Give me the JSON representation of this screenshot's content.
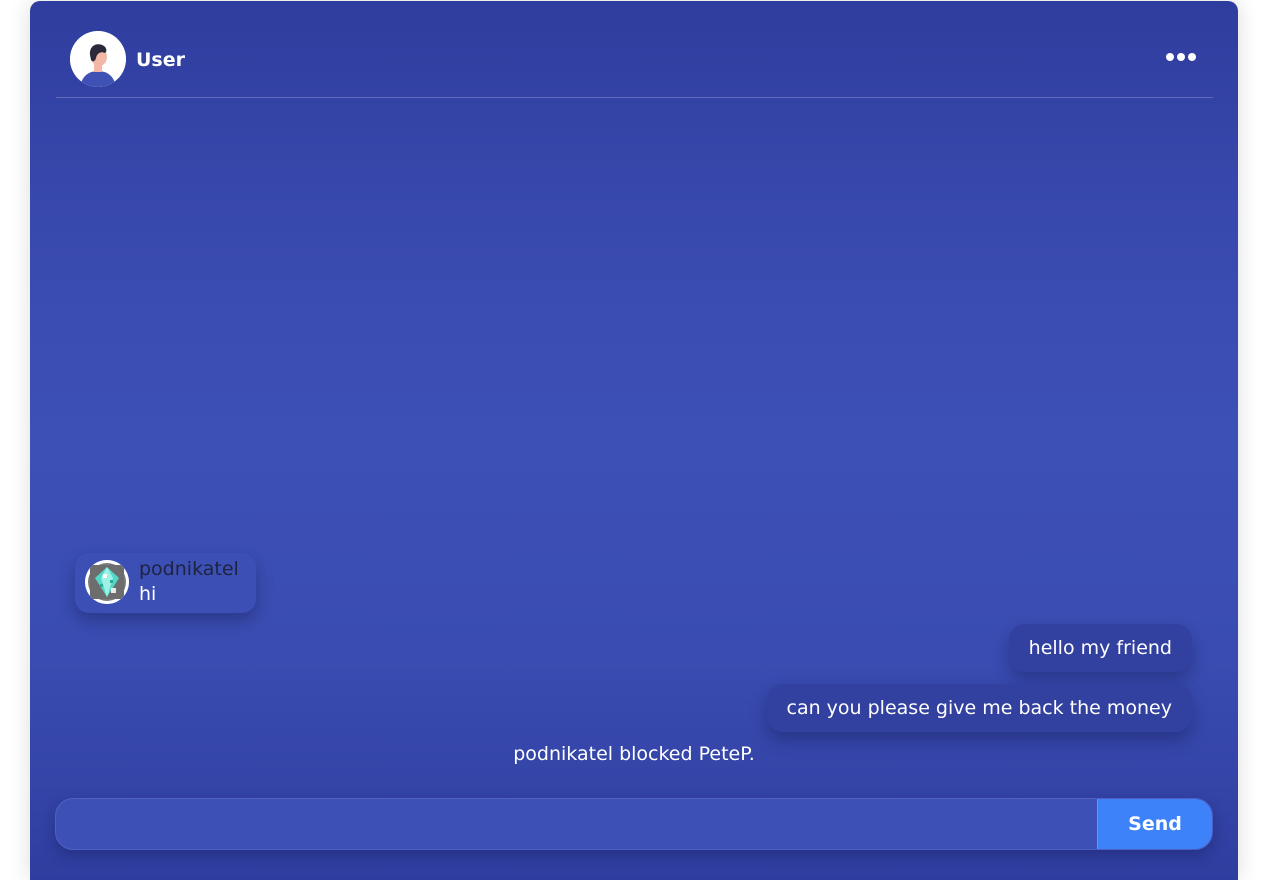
{
  "header": {
    "user_name": "User",
    "avatar_icon": "user-avatar-icon",
    "menu_icon": "more-dots-icon"
  },
  "messages": [
    {
      "direction": "received",
      "sender": "podnikatel",
      "text": "hi",
      "avatar_icon": "diamond-avatar-icon"
    },
    {
      "direction": "sent",
      "text": "hello my friend"
    },
    {
      "direction": "sent",
      "text": "can you please give me back the money"
    }
  ],
  "system_message": "podnikatel blocked PeteP.",
  "composer": {
    "placeholder": "",
    "value": "",
    "send_label": "Send"
  },
  "colors": {
    "panel": "#3a4bb0",
    "sent_bubble": "#32409f",
    "received_bubble": "#3c4fb5",
    "send_button": "#3d82f8"
  }
}
